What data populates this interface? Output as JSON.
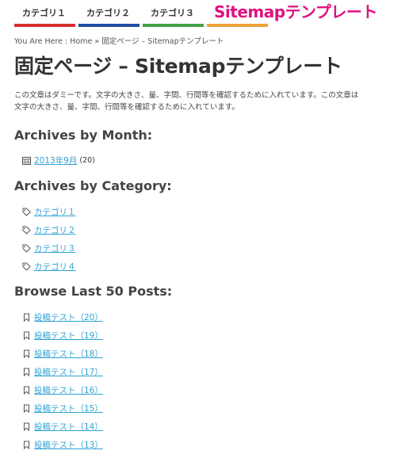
{
  "nav": {
    "items": [
      {
        "label": "カテゴリ１",
        "color": "#d32f2f"
      },
      {
        "label": "カテゴリ２",
        "color": "#1e4fa0"
      },
      {
        "label": "カテゴリ３",
        "color": "#43a047"
      },
      {
        "label": "",
        "color": "#f0a23c"
      }
    ],
    "overlay_title": "Sitemapテンプレート"
  },
  "breadcrumb": {
    "prefix": "You Are Here :",
    "home": "Home",
    "separator": "»",
    "current": "固定ページ – Sitemapテンプレート"
  },
  "page": {
    "title": "固定ページ – Sitemapテンプレート",
    "intro_line1": "この文章はダミーです。文字の大きさ、量、字間、行間等を確認するために入れています。この文章は",
    "intro_line2": "文字の大きさ、量、字間、行間等を確認するために入れています。"
  },
  "archives_by_month": {
    "heading": "Archives by Month:",
    "items": [
      {
        "label": "2013年9月",
        "count": "(20)",
        "icon": "calendar-icon"
      }
    ]
  },
  "archives_by_category": {
    "heading": "Archives by Category:",
    "items": [
      {
        "label": "カテゴリ１",
        "icon": "tag-icon"
      },
      {
        "label": "カテゴリ２",
        "icon": "tag-icon"
      },
      {
        "label": "カテゴリ３",
        "icon": "tag-icon"
      },
      {
        "label": "カテゴリ４",
        "icon": "tag-icon"
      }
    ]
  },
  "browse_last_posts": {
    "heading": "Browse Last 50 Posts:",
    "items": [
      {
        "label": "投稿テスト（20）",
        "icon": "bookmark-icon"
      },
      {
        "label": "投稿テスト（19）",
        "icon": "bookmark-icon"
      },
      {
        "label": "投稿テスト（18）",
        "icon": "bookmark-icon"
      },
      {
        "label": "投稿テスト（17）",
        "icon": "bookmark-icon"
      },
      {
        "label": "投稿テスト（16）",
        "icon": "bookmark-icon"
      },
      {
        "label": "投稿テスト（15）",
        "icon": "bookmark-icon"
      },
      {
        "label": "投稿テスト（14）",
        "icon": "bookmark-icon"
      },
      {
        "label": "投稿テスト（13）",
        "icon": "bookmark-icon"
      }
    ]
  },
  "colors": {
    "link": "#2ea3d6",
    "overlay": "#e0117f"
  }
}
